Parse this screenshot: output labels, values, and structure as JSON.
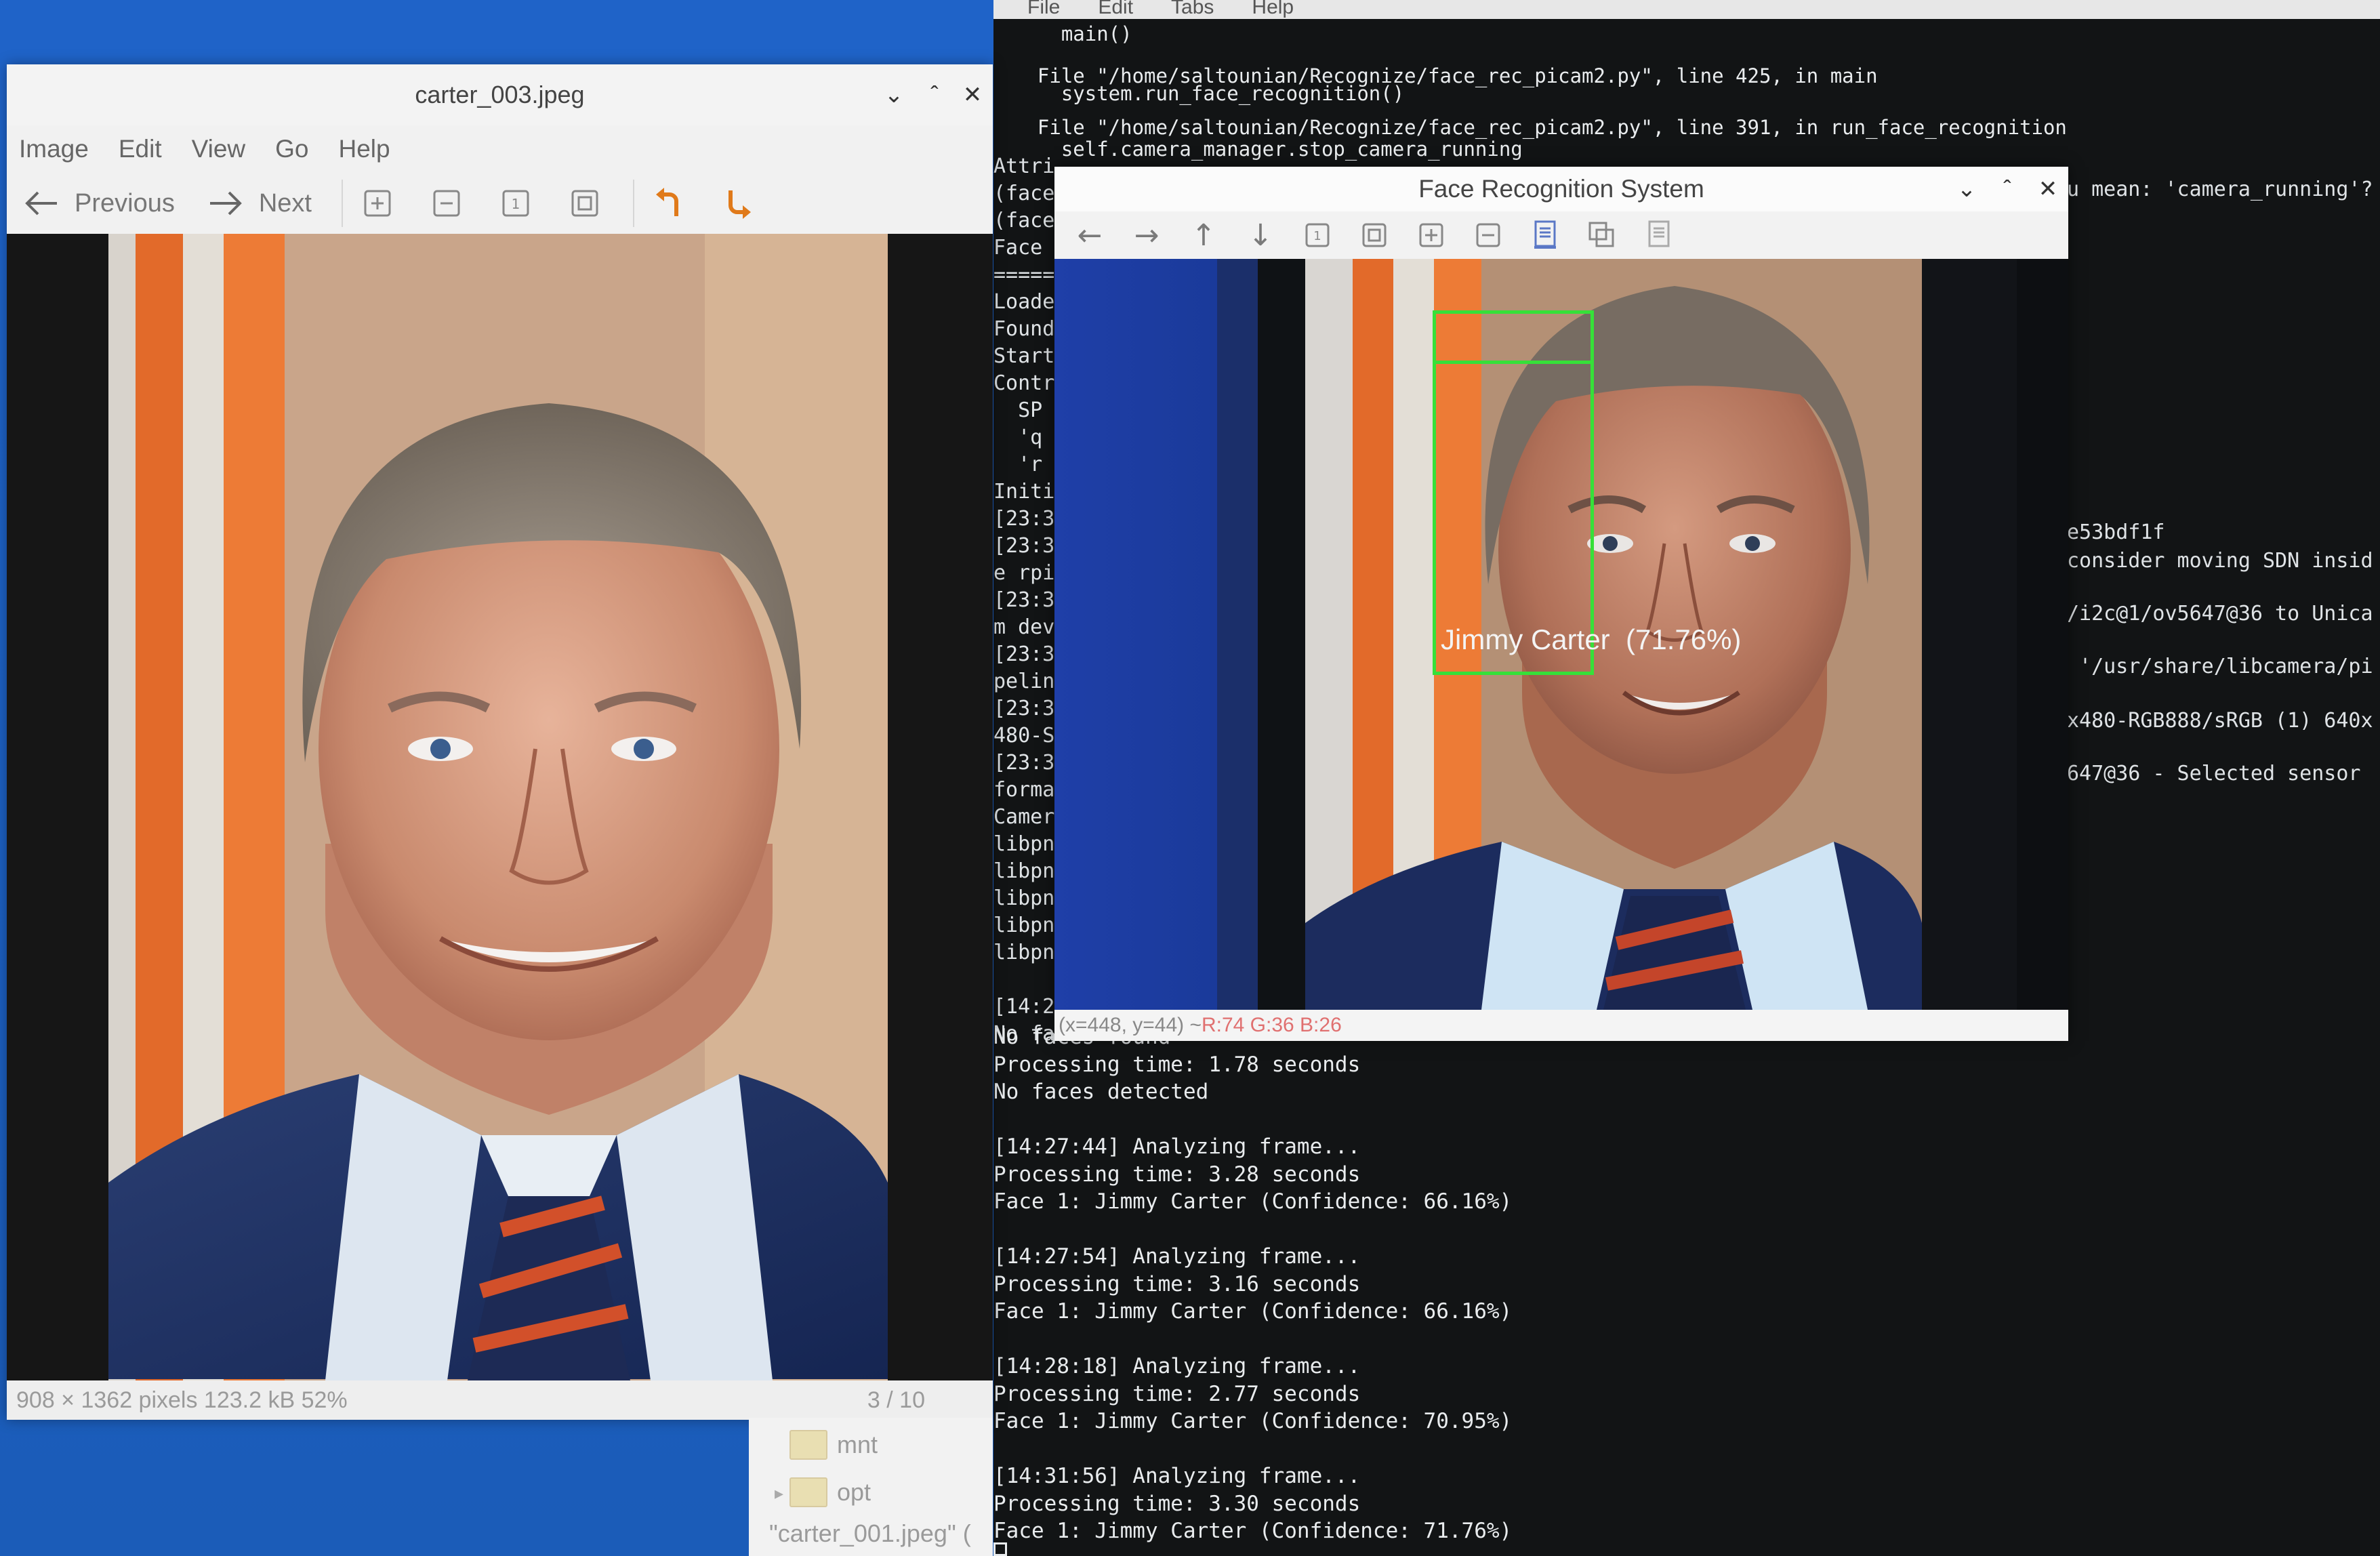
{
  "terminal": {
    "menubar": [
      "File",
      "Edit",
      "Tabs",
      "Help"
    ],
    "traceback": [
      "    main()",
      "  File \"/home/saltounian/Recognize/face_rec_picam2.py\", line 425, in main",
      "    system.run_face_recognition()",
      "  File \"/home/saltounian/Recognize/face_rec_picam2.py\", line 391, in run_face_recognition",
      "    self.camera_manager.stop_camera_running"
    ],
    "left_fragments": [
      "Attri",
      "(face",
      "(face",
      "Face",
      "=====",
      "Loade",
      "Found",
      "Start",
      "Contr",
      "  SP",
      "  'q",
      "  'r",
      "Initi",
      "[23:3",
      "[23:3",
      "e rpi",
      "[23:3",
      "m dev",
      "[23:3",
      "pelin",
      "[23:3",
      "480-S",
      "[23:3",
      "forma",
      "Camer",
      "libpn",
      "libpn",
      "libpn",
      "libpn",
      "libpn",
      "",
      "[14:2",
      "No fa"
    ],
    "right_fragments": [
      "u mean: 'camera_running'?",
      "e53bdf1f",
      "consider moving SDN insid",
      "/i2c@1/ov5647@36 to Unica",
      " '/usr/share/libcamera/pi",
      "x480-RGB888/sRGB (1) 640x",
      "647@36 - Selected sensor"
    ],
    "log": [
      "No faces found",
      "Processing time: 1.78 seconds",
      "No faces detected",
      "",
      "[14:27:44] Analyzing frame...",
      "Processing time: 3.28 seconds",
      "Face 1: Jimmy Carter (Confidence: 66.16%)",
      "",
      "[14:27:54] Analyzing frame...",
      "Processing time: 3.16 seconds",
      "Face 1: Jimmy Carter (Confidence: 66.16%)",
      "",
      "[14:28:18] Analyzing frame...",
      "Processing time: 2.77 seconds",
      "Face 1: Jimmy Carter (Confidence: 70.95%)",
      "",
      "[14:31:56] Analyzing frame...",
      "Processing time: 3.30 seconds",
      "Face 1: Jimmy Carter (Confidence: 71.76%)"
    ]
  },
  "viewer": {
    "title": "carter_003.jpeg",
    "menu": [
      "Image",
      "Edit",
      "View",
      "Go",
      "Help"
    ],
    "prev_label": "Previous",
    "next_label": "Next",
    "status": "908 × 1362 pixels  123.2 kB   52%",
    "position": "3 / 10"
  },
  "filemgr": {
    "items": [
      "mnt",
      "opt"
    ],
    "footer": "\"carter_001.jpeg\" ("
  },
  "facewin": {
    "title": "Face Recognition System",
    "label": "Jimmy Carter  (71.76%)",
    "status_prefix": "(x=448, y=44) ~ ",
    "status_color": "R:74 G:36 B:26"
  },
  "colors": {
    "detection_box": "#36e039",
    "desktop": "#1f63c8",
    "terminal_bg": "#121415"
  }
}
